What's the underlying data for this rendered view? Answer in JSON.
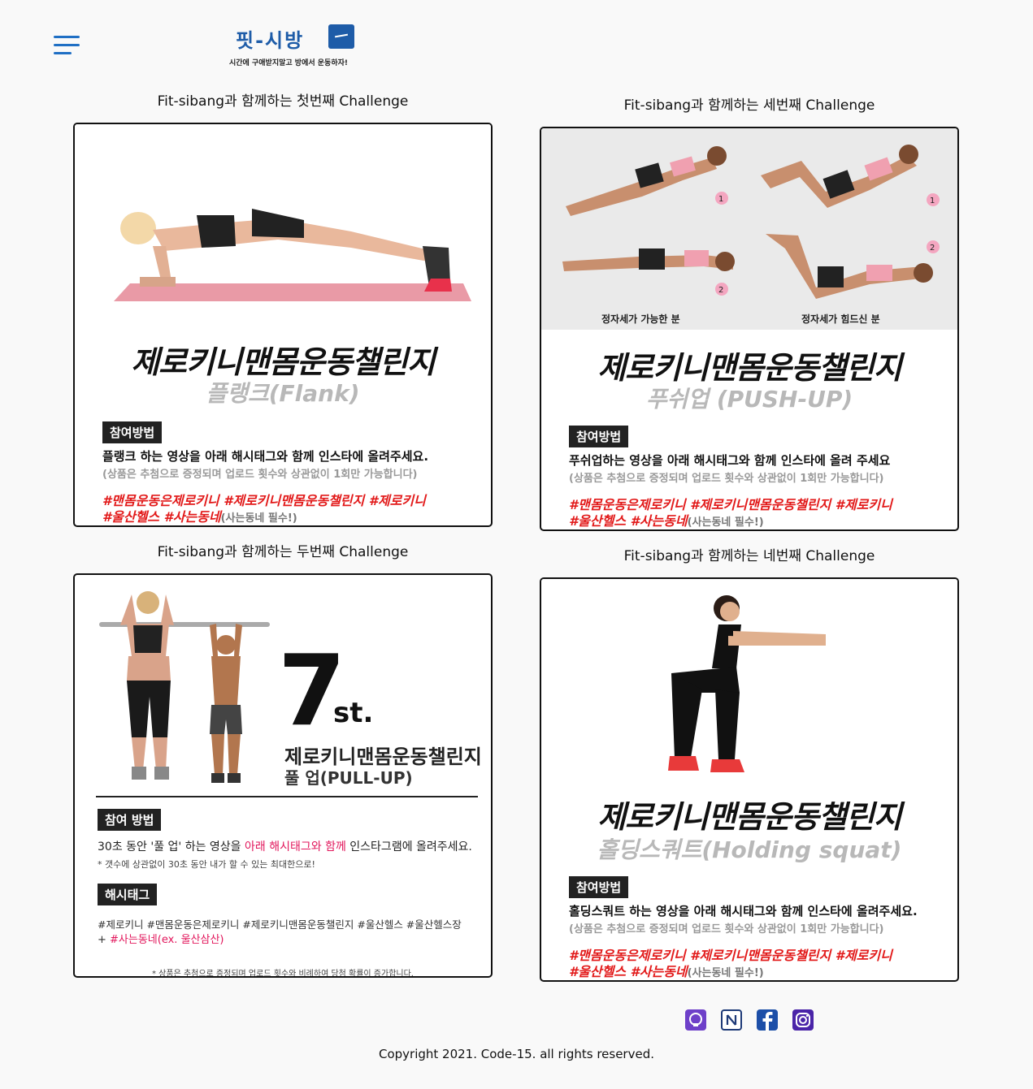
{
  "header": {
    "menu_icon": "hamburger-menu-icon",
    "logo_title": "핏-시방",
    "logo_subtitle": "시간에 구애받지말고 방에서 운동하자!",
    "accent_color": "#1f6fc4"
  },
  "challenges": [
    {
      "title": "Fit-sibang과 함께하는 첫번째 Challenge",
      "headline": "제로키니맨몸운동챌린지",
      "subheadline": "플랭크(Flank)",
      "tag": "참여방법",
      "instruction": "플랭크 하는 영상을 아래 해시태그와 함께 인스타에 올려주세요.",
      "note": "(상품은 추첨으로 증정되며 업로드 횟수와 상관없이 1회만 가능합니다)",
      "hashtags_1": "#맨몸운동은제로키니 #제로키니맨몸운동챌린지 #제로키니",
      "hashtags_2": "#울산헬스 #사는동네",
      "hashtags_2_note": "(사는동네 필수!)"
    },
    {
      "title": "Fit-sibang과 함께하는 세번째 Challenge",
      "photo_caption_left": "정자세가 가능한 분",
      "photo_caption_right": "정자세가 힘드신 분",
      "headline": "제로키니맨몸운동챌린지",
      "subheadline": "푸쉬업 (PUSH-UP)",
      "tag": "참여방법",
      "instruction": "푸쉬업하는 영상을 아래 해시태그와 함께 인스타에 올려 주세요",
      "note": "(상품은 추첨으로 증정되며 업로드 횟수와 상관없이 1회만 가능합니다)",
      "hashtags_1": "#맨몸운동은제로키니 #제로키니맨몸운동챌린지 #제로키니",
      "hashtags_2": "#울산헬스 #사는동네",
      "hashtags_2_note": "(사는동네 필수!)"
    },
    {
      "title": "Fit-sibang과 함께하는 두번째 Challenge",
      "big_number": "7",
      "big_suffix": "st.",
      "headline": "제로키니맨몸운동챌린지",
      "subheadline": "풀 업(PULL-UP)",
      "tag": "참여 방법",
      "instruction_a": "30초 동안 '풀 업' 하는 영상을 ",
      "instruction_b": "아래 해시태그와 함께",
      "instruction_c": " 인스타그램에 올려주세요.",
      "note": "* 갯수에 상관없이 30초 동안 내가 할 수 있는 최대한으로!",
      "tag2": "해시태그",
      "hashtags_1": "#제로키니 #맨몸운동은제로키니 #제로키니맨몸운동챌린지 #울산헬스 #울산헬스장",
      "hashtags_2a": "+ ",
      "hashtags_2b": "#사는동네(ex. 울산삼산)",
      "footnote": "* 상품은 추첨으로 증정되며 업로드 횟수와 비례하여 당첨 확률이 증가합니다."
    },
    {
      "title": "Fit-sibang과 함께하는 네번째 Challenge",
      "headline": "제로키니맨몸운동챌린지",
      "subheadline": "홀딩스쿼트(Holding squat)",
      "tag": "참여방법",
      "instruction": "홀딩스쿼트 하는 영상을 아래 해시태그와 함께 인스타에 올려주세요.",
      "note": "(상품은 추첨으로 증정되며 업로드 횟수와 상관없이 1회만 가능합니다)",
      "hashtags_1": "#맨몸운동은제로키니 #제로키니맨몸운동챌린지 #제로키니",
      "hashtags_2": "#울산헬스 #사는동네",
      "hashtags_2_note": "(사는동네 필수!)"
    }
  ],
  "footer": {
    "social_icons": [
      "github-icon",
      "notion-icon",
      "facebook-icon",
      "instagram-icon"
    ],
    "copyright": "Copyright 2021. Code-15. all rights reserved."
  }
}
